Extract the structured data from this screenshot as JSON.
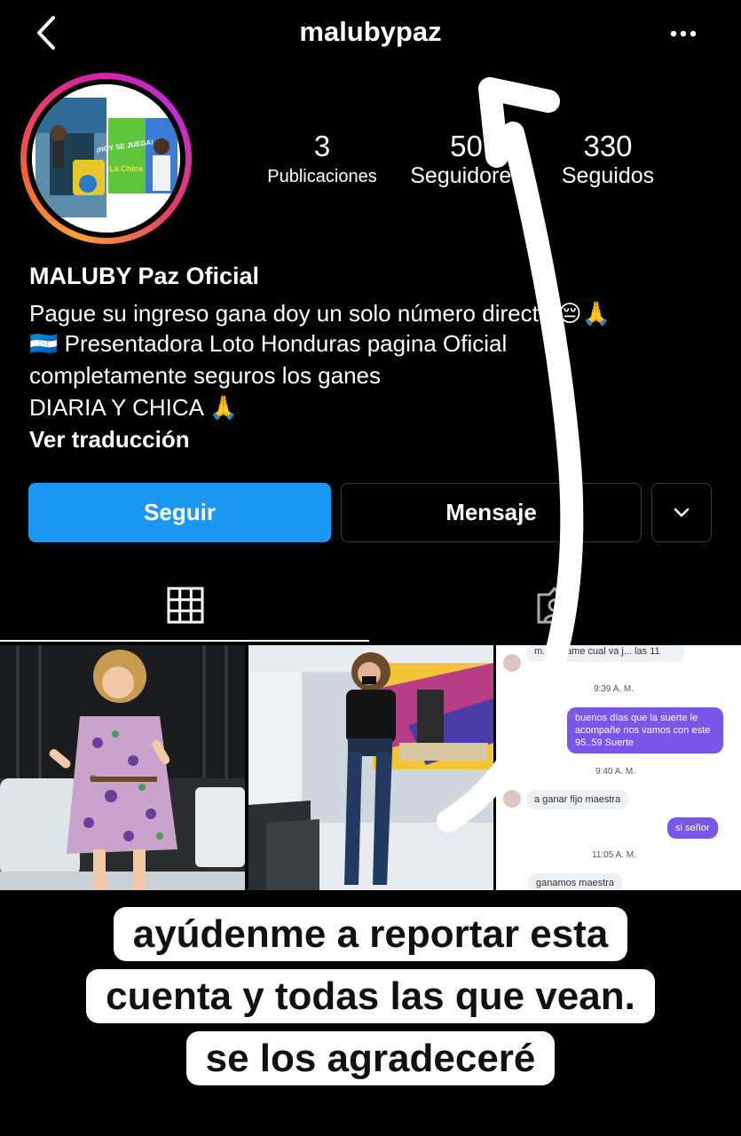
{
  "header": {
    "username": "malubypaz",
    "back_icon": "chevron-left-icon",
    "more_icon": "ellipsis-icon"
  },
  "avatar": {
    "badge_top": "¡HOY SE JUEGA!",
    "badge_logo": "La Chica"
  },
  "stats": [
    {
      "value": "3",
      "label": "Publicaciones"
    },
    {
      "value": "50",
      "label": "Seguidores"
    },
    {
      "value": "330",
      "label": "Seguidos"
    }
  ],
  "bio": {
    "name": "MALUBY Paz Oficial",
    "lines": [
      "Pague su ingreso gana doy un solo número directo 😔🙏",
      "🇭🇳 Presentadora Loto Honduras pagina Oficial",
      "completamente seguros los ganes",
      "DIARIA Y CHICA 🙏"
    ],
    "see_translation": "Ver traducción"
  },
  "buttons": {
    "follow": "Seguir",
    "message": "Mensaje"
  },
  "tabs": {
    "grid_icon": "grid-icon",
    "tagged_icon": "tagged-person-icon"
  },
  "chat": {
    "messages": [
      {
        "type": "in",
        "text": "m... digame cual va j... las 11"
      },
      {
        "type": "time",
        "text": "9:39 A. M."
      },
      {
        "type": "out",
        "text": "buenos días que la suerte le acompañe nos vamos con este 95..59 Suerte"
      },
      {
        "type": "time",
        "text": "9:40 A. M."
      },
      {
        "type": "in",
        "text": "a ganar fijo maestra"
      },
      {
        "type": "out",
        "text": "si señor"
      },
      {
        "type": "time",
        "text": "11:05 A. M."
      },
      {
        "type": "in",
        "text": "ganamos maestra"
      }
    ]
  },
  "caption": {
    "line1": "ayúdenme a reportar esta",
    "line2": "cuenta y todas las que vean.",
    "line3": "se los agradeceré"
  },
  "colors": {
    "follow_button": "#1c97f2",
    "chat_outgoing": "#7b55e8",
    "background": "#000000"
  }
}
